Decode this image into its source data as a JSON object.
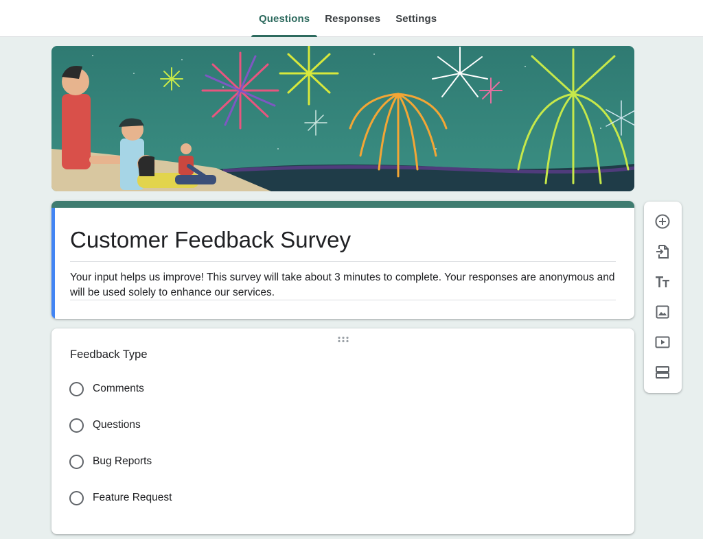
{
  "tabs": [
    {
      "label": "Questions",
      "active": true
    },
    {
      "label": "Responses",
      "active": false
    },
    {
      "label": "Settings",
      "active": false
    }
  ],
  "form": {
    "title": "Customer Feedback Survey",
    "description": "Your input helps us improve! This survey will take about 3 minutes to complete. Your responses are anonymous and will be used solely to enhance our services."
  },
  "question": {
    "title": "Feedback Type",
    "options": [
      "Comments",
      "Questions",
      "Bug Reports",
      "Feature Request"
    ]
  },
  "toolbar": {
    "icons": [
      "add-question-icon",
      "import-questions-icon",
      "add-title-icon",
      "add-image-icon",
      "add-video-icon",
      "add-section-icon"
    ]
  },
  "colors": {
    "accent": "#2d6a5e",
    "theme_header": "#3f7c70",
    "focus_bar": "#4285f4",
    "background": "#e8efee"
  }
}
